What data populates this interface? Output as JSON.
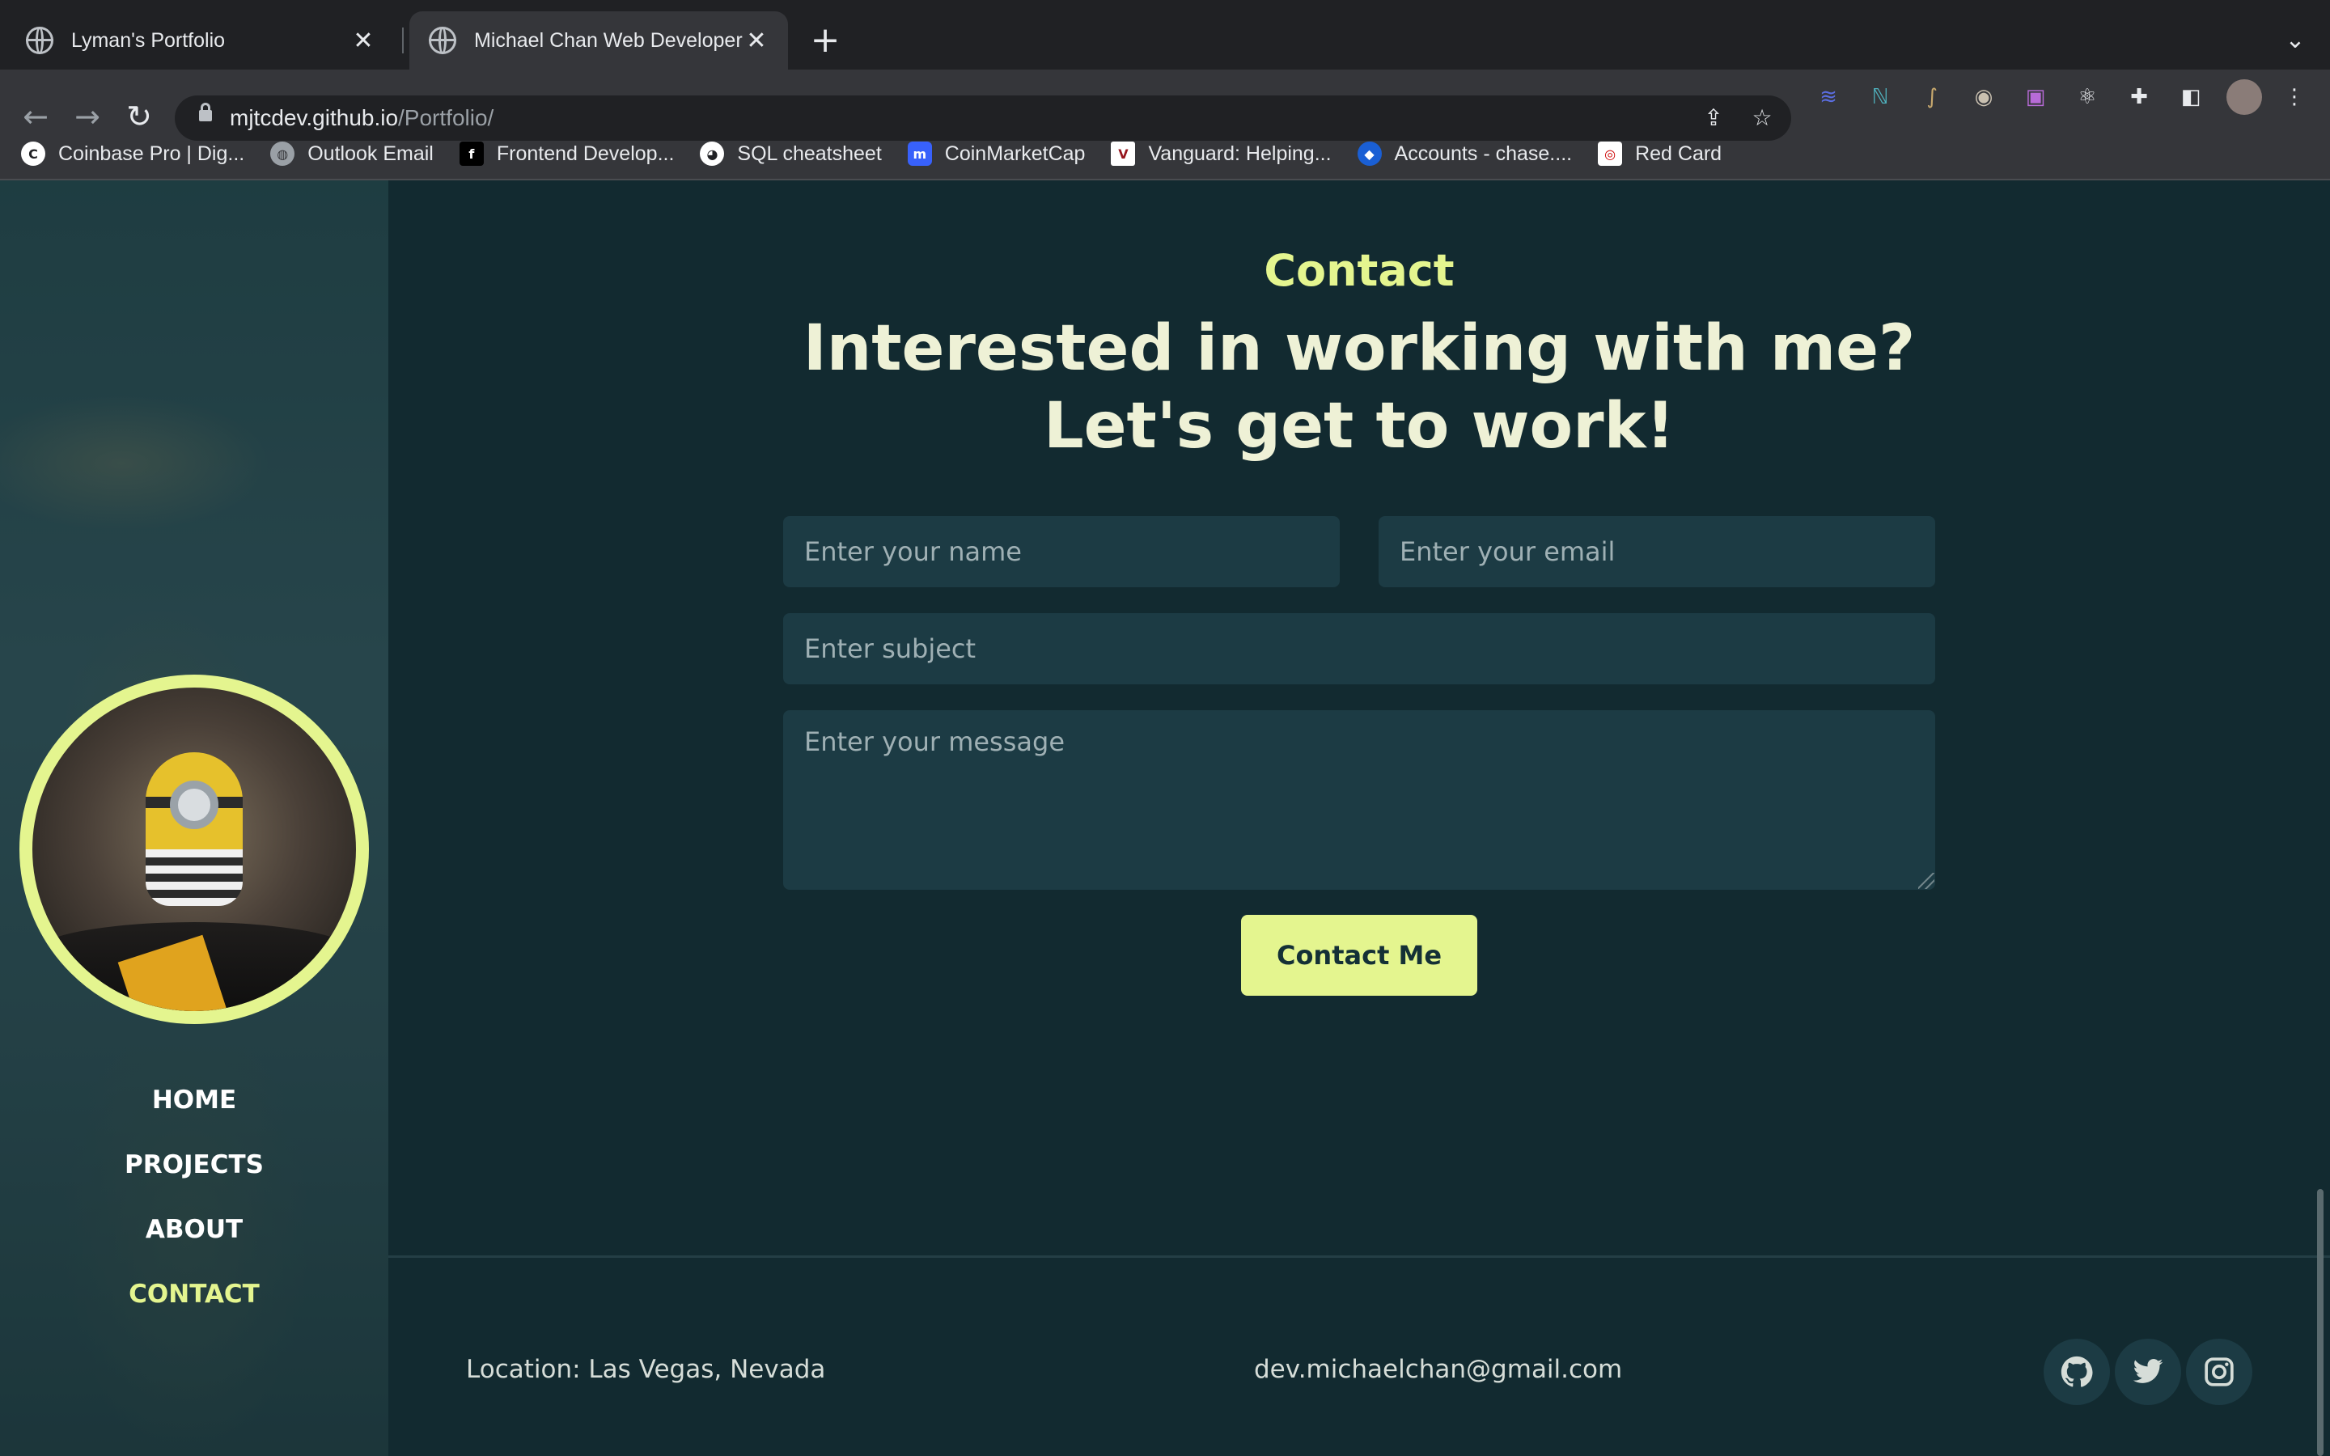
{
  "browser": {
    "tabs": [
      {
        "title": "Lyman's Portfolio",
        "active": false
      },
      {
        "title": "Michael Chan Web Developer",
        "active": true
      }
    ],
    "new_tab_icon": "plus-icon",
    "url_host": "mjtcdev.github.io",
    "url_path": "/Portfolio/",
    "bookmarks": [
      {
        "label": "Coinbase Pro | Dig...",
        "icon": "coinbase-icon",
        "color": "#ffffff"
      },
      {
        "label": "Outlook Email",
        "icon": "globe-icon",
        "color": "#9aa0a6"
      },
      {
        "label": "Frontend Develop...",
        "icon": "frontend-icon",
        "color": "#000000"
      },
      {
        "label": "SQL cheatsheet",
        "icon": "github-icon",
        "color": "#ffffff"
      },
      {
        "label": "CoinMarketCap",
        "icon": "coinmarketcap-icon",
        "color": "#3861fb"
      },
      {
        "label": "Vanguard: Helping...",
        "icon": "vanguard-icon",
        "color": "#96151d"
      },
      {
        "label": "Accounts - chase....",
        "icon": "chase-icon",
        "color": "#1a5fd4"
      },
      {
        "label": "Red Card",
        "icon": "target-icon",
        "color": "#cc0000"
      }
    ]
  },
  "sidebar": {
    "nav": [
      {
        "label": "HOME",
        "active": false
      },
      {
        "label": "PROJECTS",
        "active": false
      },
      {
        "label": "ABOUT",
        "active": false
      },
      {
        "label": "CONTACT",
        "active": true
      }
    ]
  },
  "contact": {
    "eyebrow": "Contact",
    "headline": "Interested in working with me? Let's get to work!",
    "name_placeholder": "Enter your name",
    "email_placeholder": "Enter your email",
    "subject_placeholder": "Enter subject",
    "message_placeholder": "Enter your message",
    "button_label": "Contact Me"
  },
  "footer": {
    "location": "Location: Las Vegas, Nevada",
    "email": "dev.michaelchan@gmail.com",
    "socials": [
      "github-icon",
      "twitter-icon",
      "instagram-icon"
    ]
  },
  "colors": {
    "accent": "#e4f58f",
    "background": "#122a30",
    "field": "#1c3b44"
  }
}
